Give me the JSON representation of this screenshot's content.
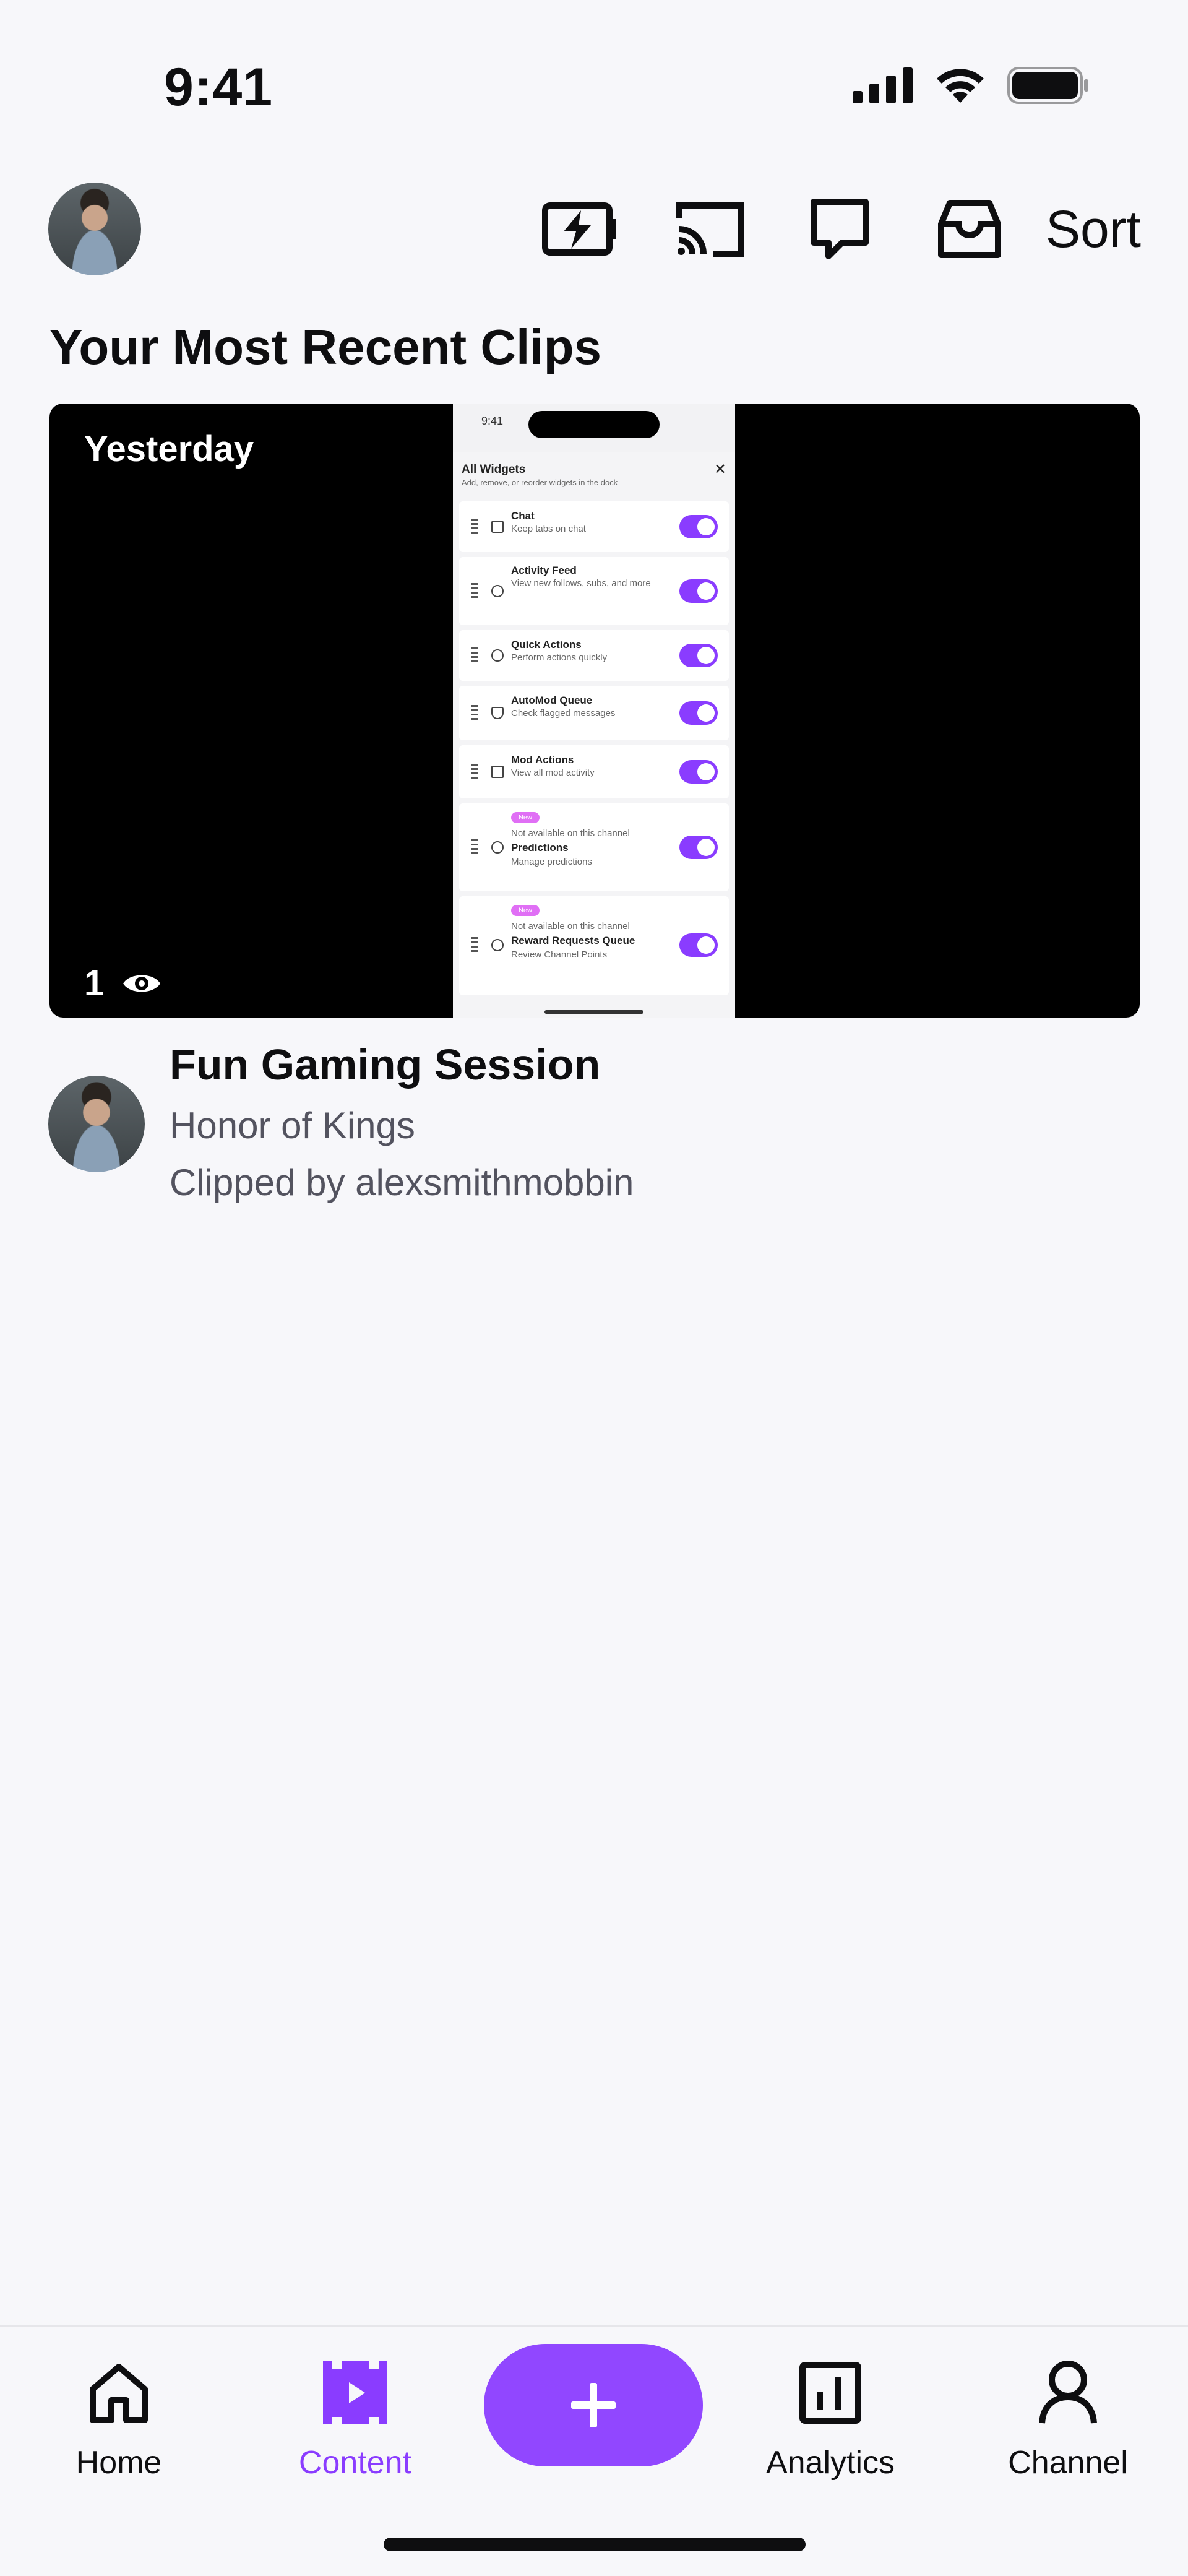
{
  "status_bar": {
    "time": "9:41",
    "icons": [
      "signal-icon",
      "wifi-icon",
      "battery-icon"
    ]
  },
  "header": {
    "icons": [
      "stream-together-icon",
      "cast-icon",
      "chat-icon",
      "inbox-icon"
    ],
    "sort_label": "Sort"
  },
  "section": {
    "title": "Your Most Recent Clips"
  },
  "clip": {
    "date_label": "Yesterday",
    "views": "1",
    "title": "Fun Gaming Session",
    "game": "Honor of Kings",
    "clipped_by": "Clipped by alexsmithmobbin",
    "preview": {
      "time": "9:41",
      "sheet_title": "All Widgets",
      "sheet_subtitle": "Add, remove, or reorder widgets in the dock",
      "tag": "New",
      "unavailable_note": "Not available on this channel",
      "widgets": [
        {
          "name": "Chat",
          "desc": "Keep tabs on chat"
        },
        {
          "name": "Activity Feed",
          "desc": "View new follows, subs, and more"
        },
        {
          "name": "Quick Actions",
          "desc": "Perform actions quickly"
        },
        {
          "name": "AutoMod Queue",
          "desc": "Check flagged messages"
        },
        {
          "name": "Mod Actions",
          "desc": "View all mod activity"
        },
        {
          "name": "Predictions",
          "desc": "Manage predictions"
        },
        {
          "name": "Reward Requests Queue",
          "desc": "Review Channel Points"
        }
      ]
    }
  },
  "tab_bar": {
    "accent_color": "#9147ff",
    "tabs": [
      {
        "label": "Home",
        "icon": "home-icon",
        "active": false
      },
      {
        "label": "Content",
        "icon": "content-icon",
        "active": true
      },
      {
        "label": "Analytics",
        "icon": "analytics-icon",
        "active": false
      },
      {
        "label": "Channel",
        "icon": "profile-icon",
        "active": false
      }
    ],
    "create_icon": "plus-icon"
  }
}
